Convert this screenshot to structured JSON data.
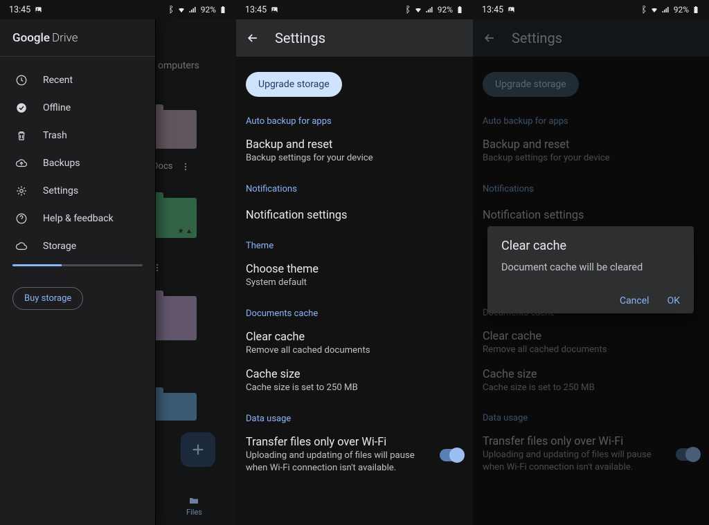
{
  "status": {
    "time": "13:45",
    "battery_pct": "92%"
  },
  "drawer": {
    "app_google": "Google",
    "app_drive": "Drive",
    "recent": "Recent",
    "offline": "Offline",
    "trash": "Trash",
    "backups": "Backups",
    "settings": "Settings",
    "help": "Help & feedback",
    "storage": "Storage",
    "storage_pct": 38,
    "buy": "Buy storage"
  },
  "bg": {
    "tab_computers": "omputers",
    "docs": "Docs",
    "files": "Files"
  },
  "settings": {
    "title": "Settings",
    "upgrade": "Upgrade storage",
    "auto_backup_hdr": "Auto backup for apps",
    "backup_title": "Backup and reset",
    "backup_sub": "Backup settings for your device",
    "notifications_hdr": "Notifications",
    "notif_title": "Notification settings",
    "theme_hdr": "Theme",
    "choose_theme": "Choose theme",
    "theme_sub": "System default",
    "docs_hdr": "Documents cache",
    "clear_cache": "Clear cache",
    "clear_cache_sub": "Remove all cached documents",
    "cache_size": "Cache size",
    "cache_size_sub": "Cache size is set to 250 MB",
    "data_hdr": "Data usage",
    "wifi_title": "Transfer files only over Wi-Fi",
    "wifi_sub": "Uploading and updating of files will pause when Wi-Fi connection isn't available."
  },
  "dialog": {
    "title": "Clear cache",
    "msg": "Document cache will be cleared",
    "cancel": "Cancel",
    "ok": "OK"
  }
}
